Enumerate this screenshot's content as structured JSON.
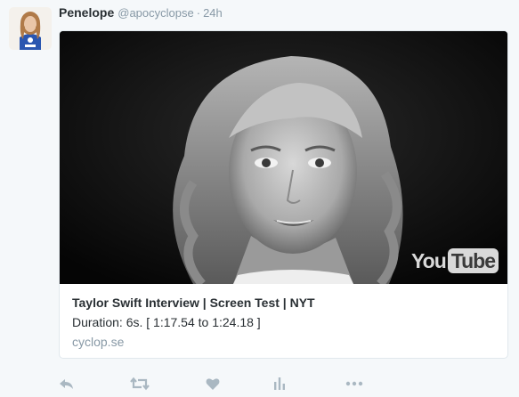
{
  "tweet": {
    "author_name": "Penelope",
    "author_handle": "@apocyclopse",
    "separator": "·",
    "timestamp": "24h"
  },
  "card": {
    "title": "Taylor Swift Interview | Screen Test | NYT",
    "description": "Duration: 6s. [ 1:17.54 to 1:24.18 ]",
    "domain": "cyclop.se",
    "logo_you": "You",
    "logo_tube": "Tube"
  },
  "actions": {
    "icons": [
      "reply-icon",
      "retweet-icon",
      "like-icon",
      "analytics-icon",
      "more-icon"
    ]
  },
  "colors": {
    "background": "#f5f8fa",
    "text": "#292f33",
    "muted": "#8899a6",
    "border": "#e1e8ed",
    "icon": "#aab8c2"
  }
}
